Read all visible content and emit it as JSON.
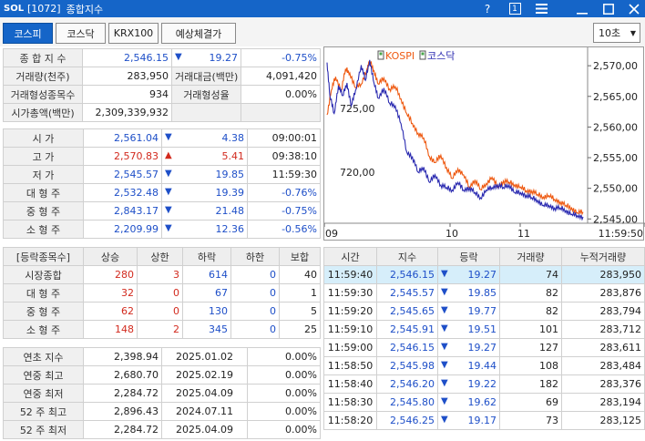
{
  "window": {
    "logo": "SOL",
    "code": "[1072]",
    "title": "종합지수",
    "help": "?",
    "one": "1",
    "menu_icon": "hamburger-icon",
    "min_icon": "minimize-icon",
    "max_icon": "maximize-icon",
    "close_icon": "close-icon"
  },
  "tabs": [
    "코스피",
    "코스닥",
    "KRX100",
    "예상체결가"
  ],
  "interval": {
    "value": "10초"
  },
  "summary": [
    [
      "종 합 지 수",
      "2,546.15",
      "▼",
      "19.27",
      "-0.75%"
    ],
    [
      "거래량(천주)",
      "283,950",
      "거래대금(백만)",
      "4,091,420"
    ],
    [
      "거래형성종목수",
      "934",
      "거래형성율",
      "0.00%"
    ],
    [
      "시가총액(백만)",
      "2,309,339,932"
    ]
  ],
  "ohlc": [
    {
      "label": "시     가",
      "value": "2,561.04",
      "dir": "▼",
      "diff": "4.38",
      "extra": "09:00:01",
      "color": "blue"
    },
    {
      "label": "고     가",
      "value": "2,570.83",
      "dir": "▲",
      "diff": "5.41",
      "extra": "09:38:10",
      "color": "red"
    },
    {
      "label": "저     가",
      "value": "2,545.57",
      "dir": "▼",
      "diff": "19.85",
      "extra": "11:59:30",
      "color": "blue"
    },
    {
      "label": "대 형 주",
      "value": "2,532.48",
      "dir": "▼",
      "diff": "19.39",
      "extra": "-0.76%",
      "color": "blue"
    },
    {
      "label": "중 형 주",
      "value": "2,843.17",
      "dir": "▼",
      "diff": "21.48",
      "extra": "-0.75%",
      "color": "blue"
    },
    {
      "label": "소 형 주",
      "value": "2,209.99",
      "dir": "▼",
      "diff": "12.36",
      "extra": "-0.56%",
      "color": "blue"
    }
  ],
  "breadth": {
    "headers": [
      "[등락종목수]",
      "상승",
      "상한",
      "하락",
      "하한",
      "보합"
    ],
    "rows": [
      [
        "시장종합",
        "280",
        "3",
        "614",
        "0",
        "40"
      ],
      [
        "대 형 주",
        "32",
        "0",
        "67",
        "0",
        "1"
      ],
      [
        "중 형 주",
        "62",
        "0",
        "130",
        "0",
        "5"
      ],
      [
        "소 형 주",
        "148",
        "2",
        "345",
        "0",
        "25"
      ]
    ]
  },
  "yearly": [
    [
      "연초  지수",
      "2,398.94",
      "2025.01.02",
      "0.00%"
    ],
    [
      "연중  최고",
      "2,680.70",
      "2025.02.19",
      "0.00%"
    ],
    [
      "연중  최저",
      "2,284.72",
      "2025.04.09",
      "0.00%"
    ],
    [
      "52 주 최고",
      "2,896.43",
      "2024.07.11",
      "0.00%"
    ],
    [
      "52 주 최저",
      "2,284.72",
      "2025.04.09",
      "0.00%"
    ]
  ],
  "ticks": {
    "headers": [
      "시간",
      "지수",
      "등락",
      "거래량",
      "누적거래량"
    ],
    "rows": [
      [
        "11:59:40",
        "2,546.15",
        "▼",
        "19.27",
        "74",
        "283,950"
      ],
      [
        "11:59:30",
        "2,545.57",
        "▼",
        "19.85",
        "82",
        "283,876"
      ],
      [
        "11:59:20",
        "2,545.65",
        "▼",
        "19.77",
        "82",
        "283,794"
      ],
      [
        "11:59:10",
        "2,545.91",
        "▼",
        "19.51",
        "101",
        "283,712"
      ],
      [
        "11:59:00",
        "2,546.15",
        "▼",
        "19.27",
        "127",
        "283,611"
      ],
      [
        "11:58:50",
        "2,545.98",
        "▼",
        "19.44",
        "108",
        "283,484"
      ],
      [
        "11:58:40",
        "2,546.20",
        "▼",
        "19.22",
        "182",
        "283,376"
      ],
      [
        "11:58:30",
        "2,545.80",
        "▼",
        "19.62",
        "69",
        "283,194"
      ],
      [
        "11:58:20",
        "2,546.25",
        "▼",
        "19.17",
        "73",
        "283,125"
      ]
    ]
  },
  "chart_data": {
    "type": "line",
    "legend": [
      "KOSPI",
      "코스닥"
    ],
    "x_ticks": [
      "09",
      "10",
      "11",
      "11:59:50"
    ],
    "y_left": {
      "ticks": [
        "725,00",
        "720,00"
      ],
      "ylim": [
        716.0,
        729.5
      ]
    },
    "y_right": {
      "ticks": [
        "2,570,00",
        "2,565,00",
        "2,560,00",
        "2,555,00",
        "2,550,00",
        "2,545,00"
      ],
      "ylim": [
        2544.3,
        2572.4
      ]
    },
    "x_range": [
      0,
      180
    ],
    "series": [
      {
        "name": "KOSPI",
        "axis": "right",
        "color": "#ee5a12",
        "points": [
          [
            0,
            2562.0
          ],
          [
            3,
            2566.0
          ],
          [
            6,
            2568.2
          ],
          [
            10,
            2566.0
          ],
          [
            13,
            2569.5
          ],
          [
            16,
            2568.8
          ],
          [
            20,
            2566.4
          ],
          [
            24,
            2567.0
          ],
          [
            28,
            2569.4
          ],
          [
            30,
            2570.8
          ],
          [
            33,
            2569.2
          ],
          [
            36,
            2567.0
          ],
          [
            40,
            2568.0
          ],
          [
            44,
            2566.2
          ],
          [
            48,
            2566.6
          ],
          [
            52,
            2564.6
          ],
          [
            56,
            2562.2
          ],
          [
            60,
            2560.6
          ],
          [
            64,
            2559.0
          ],
          [
            68,
            2558.2
          ],
          [
            72,
            2555.2
          ],
          [
            76,
            2554.2
          ],
          [
            80,
            2555.4
          ],
          [
            84,
            2553.4
          ],
          [
            88,
            2551.6
          ],
          [
            92,
            2553.2
          ],
          [
            96,
            2552.2
          ],
          [
            100,
            2550.2
          ],
          [
            104,
            2551.4
          ],
          [
            108,
            2549.8
          ],
          [
            112,
            2550.8
          ],
          [
            116,
            2551.8
          ],
          [
            120,
            2550.2
          ],
          [
            124,
            2551.2
          ],
          [
            128,
            2551.0
          ],
          [
            132,
            2550.6
          ],
          [
            136,
            2550.2
          ],
          [
            140,
            2549.6
          ],
          [
            144,
            2549.6
          ],
          [
            148,
            2549.0
          ],
          [
            152,
            2548.6
          ],
          [
            156,
            2548.8
          ],
          [
            160,
            2548.2
          ],
          [
            164,
            2547.8
          ],
          [
            168,
            2547.2
          ],
          [
            172,
            2546.8
          ],
          [
            176,
            2546.0
          ],
          [
            180,
            2546.15
          ]
        ]
      },
      {
        "name": "코스닥",
        "axis": "left",
        "color": "#2a2ab0",
        "points": [
          [
            0,
            728.6
          ],
          [
            2,
            726.0
          ],
          [
            5,
            724.6
          ],
          [
            8,
            726.8
          ],
          [
            11,
            726.0
          ],
          [
            14,
            727.0
          ],
          [
            17,
            725.2
          ],
          [
            20,
            726.4
          ],
          [
            24,
            728.4
          ],
          [
            27,
            727.2
          ],
          [
            30,
            728.8
          ],
          [
            33,
            727.0
          ],
          [
            36,
            725.8
          ],
          [
            40,
            726.6
          ],
          [
            44,
            725.4
          ],
          [
            48,
            725.2
          ],
          [
            52,
            723.8
          ],
          [
            56,
            721.6
          ],
          [
            60,
            721.2
          ],
          [
            64,
            720.0
          ],
          [
            68,
            720.4
          ],
          [
            72,
            719.2
          ],
          [
            76,
            719.8
          ],
          [
            80,
            719.0
          ],
          [
            84,
            718.8
          ],
          [
            88,
            718.6
          ],
          [
            92,
            719.2
          ],
          [
            96,
            718.6
          ],
          [
            100,
            718.8
          ],
          [
            104,
            718.4
          ],
          [
            108,
            718.0
          ],
          [
            112,
            718.6
          ],
          [
            116,
            718.8
          ],
          [
            120,
            719.0
          ],
          [
            124,
            718.8
          ],
          [
            128,
            719.0
          ],
          [
            132,
            718.4
          ],
          [
            136,
            718.4
          ],
          [
            140,
            718.2
          ],
          [
            144,
            718.0
          ],
          [
            148,
            717.8
          ],
          [
            152,
            717.4
          ],
          [
            156,
            717.4
          ],
          [
            160,
            717.2
          ],
          [
            164,
            717.2
          ],
          [
            168,
            717.0
          ],
          [
            172,
            716.7
          ],
          [
            176,
            716.6
          ],
          [
            180,
            716.5
          ]
        ]
      }
    ]
  }
}
